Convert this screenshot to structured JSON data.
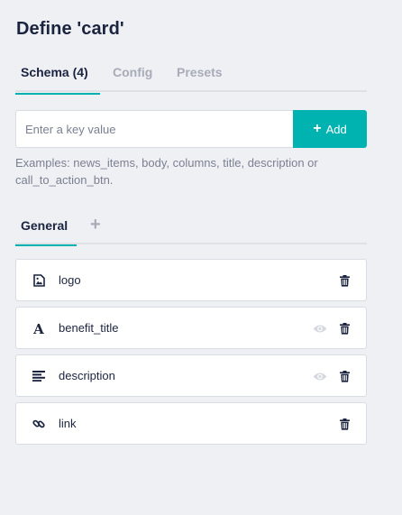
{
  "page": {
    "title": "Define 'card'"
  },
  "tabs": [
    {
      "label": "Schema (4)",
      "active": true
    },
    {
      "label": "Config",
      "active": false
    },
    {
      "label": "Presets",
      "active": false
    }
  ],
  "key_input": {
    "placeholder": "Enter a key value",
    "value": ""
  },
  "add_button": {
    "label": "Add",
    "icon": "plus-icon"
  },
  "hint": "Examples: news_items, body, columns, title, description or call_to_action_btn.",
  "group_tabs": {
    "items": [
      {
        "label": "General",
        "active": true
      }
    ],
    "add_icon": "plus-icon"
  },
  "fields": [
    {
      "label": "logo",
      "icon": "image-icon",
      "has_eye": false
    },
    {
      "label": "benefit_title",
      "icon": "text-icon",
      "has_eye": true
    },
    {
      "label": "description",
      "icon": "align-left-icon",
      "has_eye": true
    },
    {
      "label": "link",
      "icon": "link-icon",
      "has_eye": false
    }
  ],
  "colors": {
    "accent": "#00b3b0",
    "text": "#1b243f",
    "muted": "#a8acb8",
    "background": "#eff0f4"
  }
}
